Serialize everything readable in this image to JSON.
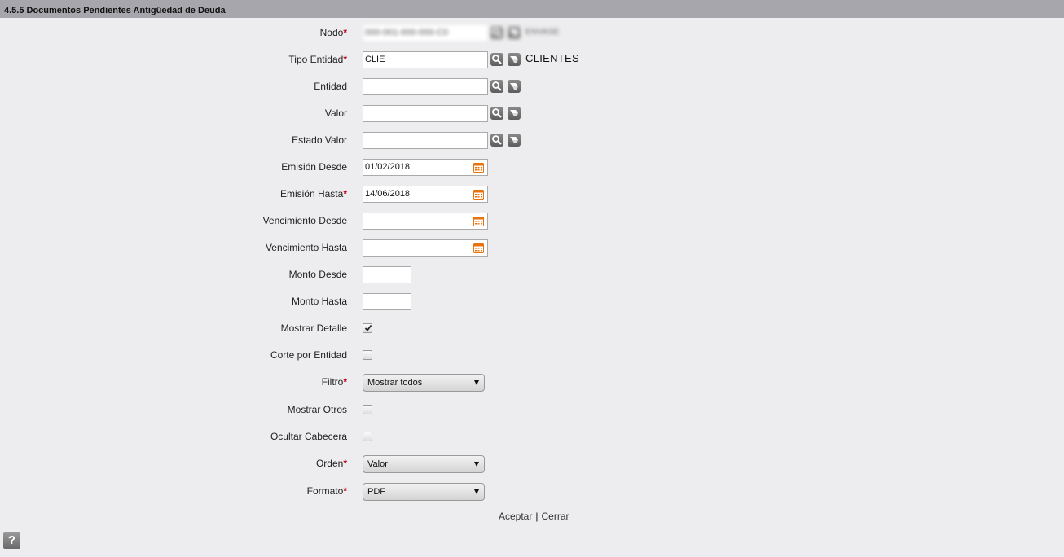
{
  "title": "4.5.5 Documentos Pendientes Antigüedad de Deuda",
  "required_mark": "*",
  "fields": {
    "nodo": {
      "label": "Nodo",
      "value": "000-001-000-000-C0",
      "entity_name": "ENVASE"
    },
    "tipo_entidad": {
      "label": "Tipo Entidad",
      "value": "CLIE",
      "entity_name": "CLIENTES"
    },
    "entidad": {
      "label": "Entidad",
      "value": ""
    },
    "valor": {
      "label": "Valor",
      "value": ""
    },
    "estado_valor": {
      "label": "Estado Valor",
      "value": ""
    },
    "emision_desde": {
      "label": "Emisión Desde",
      "value": "01/02/2018"
    },
    "emision_hasta": {
      "label": "Emisión Hasta",
      "value": "14/06/2018"
    },
    "vencimiento_desde": {
      "label": "Vencimiento Desde",
      "value": ""
    },
    "vencimiento_hasta": {
      "label": "Vencimiento Hasta",
      "value": ""
    },
    "monto_desde": {
      "label": "Monto Desde",
      "value": ""
    },
    "monto_hasta": {
      "label": "Monto Hasta",
      "value": ""
    },
    "mostrar_detalle": {
      "label": "Mostrar Detalle",
      "checked": true
    },
    "corte_por_entidad": {
      "label": "Corte por Entidad",
      "checked": false
    },
    "filtro": {
      "label": "Filtro",
      "selected": "Mostrar todos"
    },
    "mostrar_otros": {
      "label": "Mostrar Otros",
      "checked": false
    },
    "ocultar_cabecera": {
      "label": "Ocultar Cabecera",
      "checked": false
    },
    "orden": {
      "label": "Orden",
      "selected": "Valor"
    },
    "formato": {
      "label": "Formato",
      "selected": "PDF"
    }
  },
  "actions": {
    "accept": "Aceptar",
    "separator": "|",
    "close": "Cerrar"
  },
  "help": {
    "label": "?"
  },
  "icons": {
    "search": "magnifier-icon",
    "clear": "eraser-icon",
    "calendar": "calendar-icon",
    "help": "help-icon"
  },
  "colors": {
    "titlebar": "#a7a6ad",
    "background": "#ededef",
    "required": "#c0001c",
    "calendar": "#e8720c"
  }
}
